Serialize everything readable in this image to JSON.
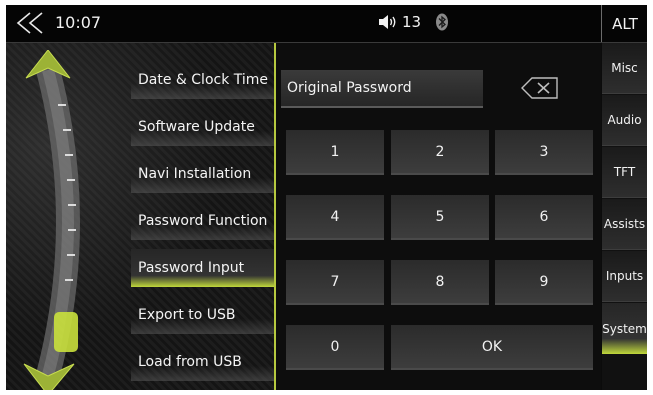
{
  "status_bar": {
    "back_icon": "double-chevron-left-icon",
    "time": "10:07",
    "volume_icon": "speaker-volume-icon",
    "volume": "13",
    "bluetooth_icon": "bluetooth-icon",
    "mode": "ALT"
  },
  "menu": {
    "items": [
      {
        "label": "Date & Clock Time"
      },
      {
        "label": "Software Update"
      },
      {
        "label": "Navi Installation"
      },
      {
        "label": "Password Function"
      },
      {
        "label": "Password Input"
      },
      {
        "label": "Export to USB"
      },
      {
        "label": "Load from USB"
      }
    ],
    "active_index": 4
  },
  "keypad": {
    "field_label": "Original Password",
    "backspace_icon": "backspace-icon",
    "keys": [
      "1",
      "2",
      "3",
      "4",
      "5",
      "6",
      "7",
      "8",
      "9",
      "0",
      "OK"
    ]
  },
  "tabs": {
    "items": [
      {
        "label": "Misc"
      },
      {
        "label": "Audio"
      },
      {
        "label": "TFT"
      },
      {
        "label": "Assists"
      },
      {
        "label": "Inputs"
      },
      {
        "label": "System"
      }
    ],
    "active_index": 5
  },
  "colors": {
    "accent": "#c0d83b",
    "background": "#0b0b0b"
  }
}
